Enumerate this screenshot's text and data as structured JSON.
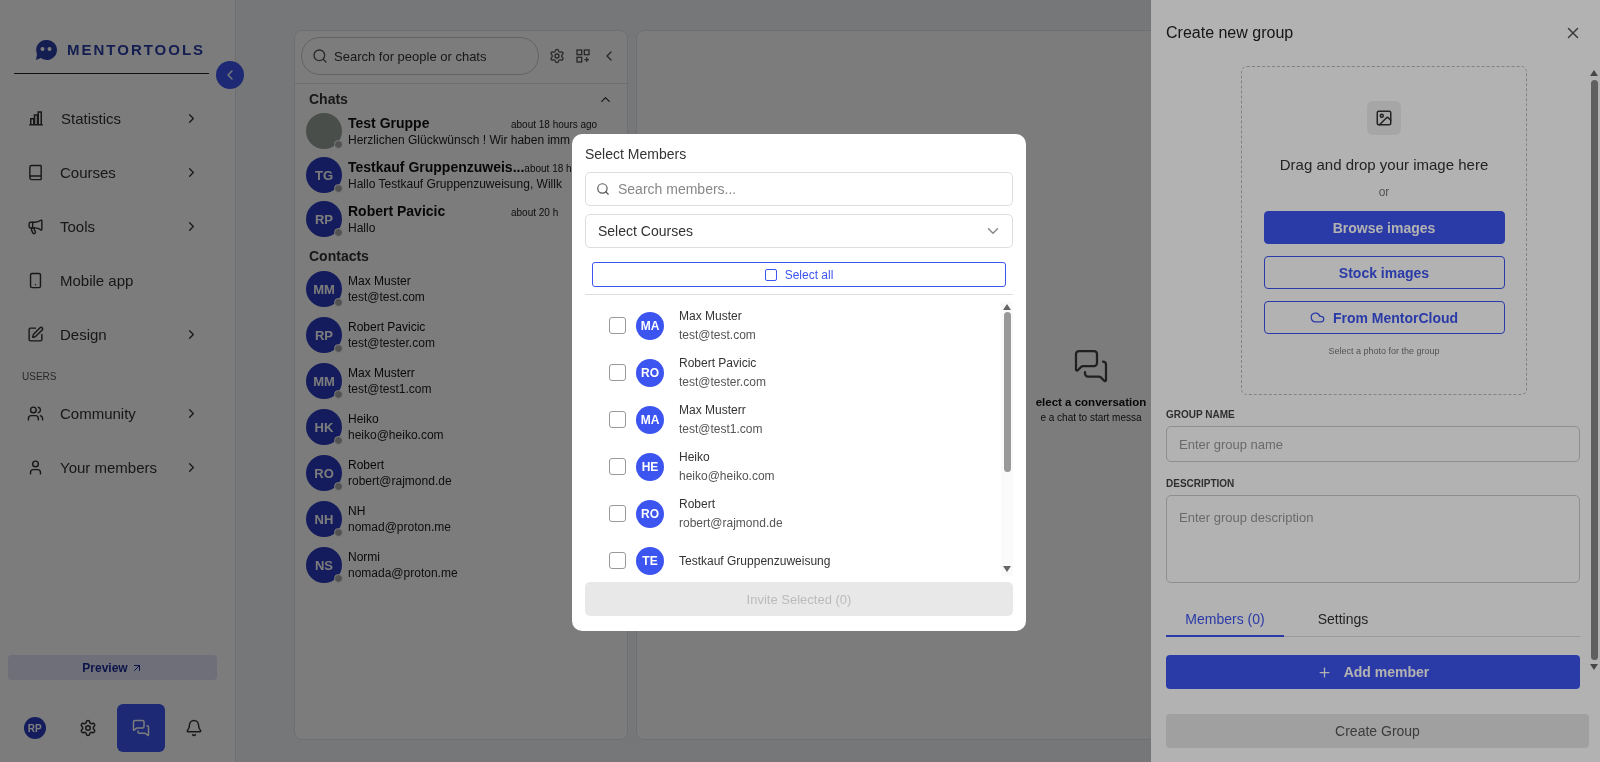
{
  "sidebar": {
    "brand": "MENTORTOOLS",
    "nav_items": [
      {
        "kind": "stats",
        "label": "Statistics",
        "has_submenu": true
      },
      {
        "kind": "book",
        "label": "Courses",
        "has_submenu": true
      },
      {
        "kind": "megaphone",
        "label": "Tools",
        "has_submenu": true
      },
      {
        "kind": "phone",
        "label": "Mobile app",
        "has_submenu": false
      },
      {
        "kind": "pen",
        "label": "Design",
        "has_submenu": true
      }
    ],
    "section": {
      "label": "USERS",
      "items": [
        {
          "kind": "users",
          "label": "Community",
          "has_submenu": true
        },
        {
          "kind": "user",
          "label": "Your members",
          "has_submenu": true
        }
      ]
    },
    "preview_button": "Preview",
    "bottom_icons": [
      {
        "kind": "avatar",
        "initials": "RP",
        "selected": false
      },
      {
        "kind": "settings",
        "selected": false
      },
      {
        "kind": "chat",
        "selected": true
      },
      {
        "kind": "bell",
        "selected": false
      }
    ]
  },
  "chat_panel": {
    "search": {
      "placeholder": "Search for people or chats"
    },
    "chats_header": "Chats",
    "chats": [
      {
        "kind": "photo",
        "name": "Test Gruppe",
        "time": "about 18 hours ago",
        "message": "Herzlichen Glückwünsch ! Wir haben imm"
      },
      {
        "kind": "initials",
        "initials": "TG",
        "name": "Testkauf Gruppenzuweis...",
        "time": "about 18 h",
        "message": "Hallo Testkauf Gruppenzuweisung, Willk"
      },
      {
        "kind": "initials",
        "initials": "RP",
        "name": "Robert Pavicic",
        "time": "about 20 h",
        "message": "Hallo"
      }
    ],
    "contacts_header": "Contacts",
    "contacts": [
      {
        "initials": "MM",
        "name": "Max Muster",
        "email": "test@test.com"
      },
      {
        "initials": "RP",
        "name": "Robert Pavicic",
        "email": "test@tester.com"
      },
      {
        "initials": "MM",
        "name": "Max Musterr",
        "email": "test@test1.com"
      },
      {
        "initials": "HK",
        "name": "Heiko",
        "email": "heiko@heiko.com"
      },
      {
        "initials": "RO",
        "name": "Robert",
        "email": "robert@rajmond.de"
      },
      {
        "initials": "NH",
        "name": "NH",
        "email": "nomad@proton.me"
      },
      {
        "initials": "NS",
        "name": "Normi",
        "email": "nomada@proton.me"
      }
    ]
  },
  "main": {
    "empty_title": "elect a conversation",
    "empty_subtitle": "e a chat to start messa"
  },
  "side_panel": {
    "title": "Create new group",
    "dropzone": {
      "text": "Drag and drop your image here",
      "or": "or",
      "buttons": [
        {
          "kind": "primary",
          "label": "Browse images"
        },
        {
          "kind": "outline",
          "label": "Stock images"
        },
        {
          "kind": "cloud",
          "label": "From MentorCloud"
        }
      ],
      "caption": "Select a photo for the group"
    },
    "group_name": {
      "label": "GROUP NAME",
      "placeholder": "Enter group name"
    },
    "description": {
      "label": "DESCRIPTION",
      "placeholder": "Enter group description"
    },
    "tabs": [
      {
        "label": "Members (0)",
        "selected": true
      },
      {
        "label": "Settings",
        "selected": false
      }
    ],
    "add_member_button": "Add member",
    "create_button": {
      "label": "Create Group",
      "disabled": true
    }
  },
  "modal": {
    "title": "Select Members",
    "search": {
      "placeholder": "Search members..."
    },
    "courses_select": {
      "placeholder": "Select Courses"
    },
    "select_all": {
      "label": "Select all",
      "checked": false
    },
    "members": [
      {
        "initials": "MA",
        "name": "Max Muster",
        "email": "test@test.com",
        "checked": false
      },
      {
        "initials": "RO",
        "name": "Robert Pavicic",
        "email": "test@tester.com",
        "checked": false
      },
      {
        "initials": "MA",
        "name": "Max Musterr",
        "email": "test@test1.com",
        "checked": false
      },
      {
        "initials": "HE",
        "name": "Heiko",
        "email": "heiko@heiko.com",
        "checked": false
      },
      {
        "initials": "RO",
        "name": "Robert",
        "email": "robert@rajmond.de",
        "checked": false
      },
      {
        "initials": "TE",
        "name": "Testkauf Gruppenzuweisung",
        "checked": false
      }
    ],
    "invite_button": {
      "label": "Invite Selected (0)",
      "disabled": true
    }
  }
}
